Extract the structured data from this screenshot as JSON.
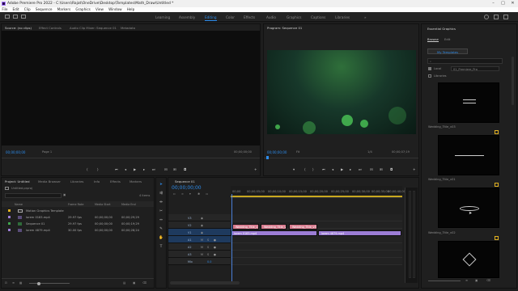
{
  "app": {
    "title": "Adobe Premiere Pro 2022 - C:\\Users\\Rajat\\OneDrive\\Desktop\\Templates\\Math_Draw\\Untitled *",
    "menu": [
      "File",
      "Edit",
      "Clip",
      "Sequence",
      "Markers",
      "Graphics",
      "View",
      "Window",
      "Help"
    ],
    "window_controls": [
      "–",
      "□",
      "✕"
    ]
  },
  "workspaces": {
    "items": [
      "Learning",
      "Assembly",
      "Editing",
      "Color",
      "Effects",
      "Audio",
      "Graphics",
      "Captions",
      "Libraries"
    ],
    "active": "Editing",
    "more": "»"
  },
  "source_panel": {
    "tabs": [
      "Source: (no clips)",
      "Effect Controls",
      "Audio Clip Mixer: Sequence 01",
      "Metadata"
    ],
    "timecode_left": "00;00;00;00",
    "page": "Page 1",
    "timecode_right": "00;00;00;00"
  },
  "program_panel": {
    "tab": "Program: Sequence 01",
    "timecode_left": "00;00;00;00",
    "fit": "Fit",
    "resolution": "1/4",
    "timecode_right": "00;00;07;19"
  },
  "project_panel": {
    "tabs": [
      "Project: Untitled",
      "Media Browser",
      "Libraries",
      "Info",
      "Effects",
      "Markers"
    ],
    "project_file": "Untitled.prproj",
    "item_count": "4 items",
    "columns": [
      "Name",
      "Frame Rate",
      "Media Start",
      "Media End"
    ],
    "rows": [
      {
        "name": "Motion Graphics Template",
        "fps": "",
        "start": "",
        "end": "",
        "color": "#e0b020"
      },
      {
        "name": "lorem 0183.mp4",
        "fps": "29.97 fps",
        "start": "00;00;00;00",
        "end": "00;00;29;29",
        "color": "#9c7dd5"
      },
      {
        "name": "Sequence 01",
        "fps": "29.97 fps",
        "start": "00;00;00;00",
        "end": "00;00;19;29",
        "color": "#3fa34d"
      },
      {
        "name": "lorem 4879.mp4",
        "fps": "30.00 fps",
        "start": "00;00;00;00",
        "end": "00;00;28;24",
        "color": "#9c7dd5"
      }
    ]
  },
  "timeline": {
    "tab": "Sequence 01",
    "timecode": "00;00;00;00",
    "ruler": [
      "00;00",
      "00;00;05;00",
      "00;00;10;00",
      "00;00;15;00",
      "00;00;20;00",
      "00;00;25;00",
      "00;00;30;00",
      "00;00;35;00",
      "00;00;40;00"
    ],
    "tracks": [
      "V3",
      "V2",
      "V1",
      "A1",
      "A2",
      "A3",
      "Mix"
    ],
    "mix_value": "0.0",
    "video_clips": [
      "Wedding_Title_v1",
      "Wedding_Title_v2",
      "Wedding_Title_v3"
    ],
    "audio_clips": [
      "lorem 0183.mp4",
      "lorem 4879.mp4"
    ]
  },
  "essential_graphics": {
    "title": "Essential Graphics",
    "tabs": [
      "Browse",
      "Edit"
    ],
    "templates_button": "My Templates",
    "local_label": "Local",
    "local_value": "01_Premiere_Pro",
    "libraries_label": "Libraries",
    "templates": [
      "Wedding_Title_v03",
      "Wedding_Title_v01",
      "Wedding_Title_v02"
    ]
  },
  "colors": {
    "accent": "#2d8ceb",
    "video_clip": "#d77b8e",
    "audio_clip": "#9c7dd5",
    "playhead": "#4a7fd6"
  }
}
